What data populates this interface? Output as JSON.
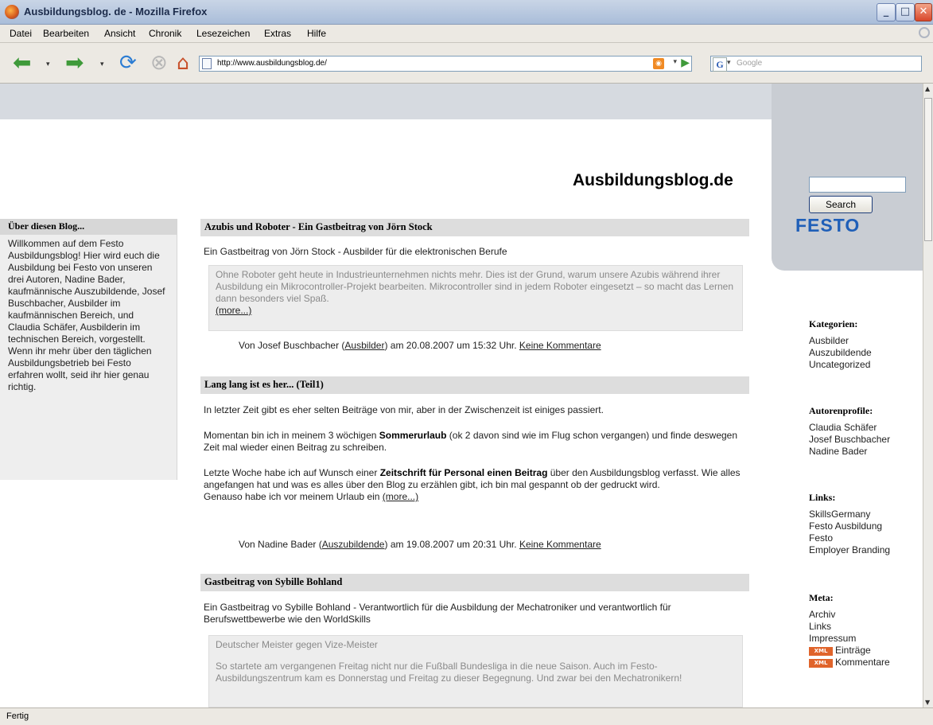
{
  "window": {
    "title": "Ausbildungsblog. de - Mozilla Firefox",
    "minimize": "_",
    "maximize": "□",
    "close": "✕"
  },
  "menu": [
    "Datei",
    "Bearbeiten",
    "Ansicht",
    "Chronik",
    "Lesezeichen",
    "Extras",
    "Hilfe"
  ],
  "nav": {
    "back_icon": "back-arrow-icon",
    "forward_icon": "forward-arrow-icon",
    "url": "http://www.ausbildungsblog.de/",
    "search_placeholder": "Google"
  },
  "page": {
    "blog_title": "Ausbildungsblog.de",
    "brand": "FESTO",
    "about": {
      "heading": "Über diesen Blog...",
      "text": "Willkommen auf dem Festo Ausbildungsblog! Hier wird euch die Ausbildung bei Festo von unseren drei Autoren, Nadine Bader, kaufmännische Auszubildende, Josef Buschbacher, Ausbilder im kaufmännischen Bereich, und Claudia Schäfer, Ausbilderin im technischen Bereich, vorgestellt. Wenn ihr mehr über den täglichen Ausbildungsbetrieb bei Festo erfahren wollt, seid ihr hier genau richtig."
    },
    "posts": [
      {
        "title": "Azubis und Roboter - Ein Gastbeitrag von Jörn Stock",
        "intro": "Ein Gastbeitrag von Jörn Stock - Ausbilder für die elektronischen Berufe",
        "quote": "Ohne Roboter geht heute in Industrieunternehmen nichts mehr. Dies ist der Grund, warum unsere Azubis während ihrer Ausbildung ein Mikrocontroller-Projekt bearbeiten. Mikrocontroller sind in jedem Roboter eingesetzt – so macht das Lernen dann besonders viel Spaß.",
        "more": "(more...)",
        "meta_prefix": "Von Josef Buschbacher (",
        "meta_cat": "Ausbilder",
        "meta_date": ") am 20.08.2007 um 15:32 Uhr.",
        "meta_comments": "Keine Kommentare"
      },
      {
        "title": "Lang lang ist es her... (Teil1)",
        "p1": "In letzter Zeit gibt es eher selten Beiträge von mir, aber in der Zwischenzeit ist einiges passiert.",
        "p2_a": "Momentan bin ich in meinem 3 wöchigen ",
        "p2_b": "Sommerurlaub",
        "p2_c": " (ok 2 davon sind wie im Flug schon vergangen) und finde deswegen Zeit mal wieder einen Beitrag zu schreiben.",
        "p3_a": "Letzte Woche habe ich auf Wunsch einer ",
        "p3_b": "Zeitschrift für Personal einen Beitrag",
        "p3_c": " über den Ausbildungsblog verfasst. Wie alles angefangen hat und was es alles über den Blog zu erzählen gibt, ich bin mal gespannt ob der gedruckt wird.",
        "p4": "Genauso habe ich vor meinem Urlaub ein ",
        "more": "(more...)",
        "meta_prefix": "Von Nadine Bader (",
        "meta_cat": "Auszubildende",
        "meta_date": ") am 19.08.2007 um 20:31 Uhr.",
        "meta_comments": "Keine Kommentare"
      },
      {
        "title": "Gastbeitrag von Sybille Bohland",
        "intro": "Ein Gastbeitrag vo Sybille Bohland - Verantwortlich für die Ausbildung der Mechatroniker und verantwortlich für Berufswettbewerbe wie den WorldSkills",
        "quote_title": "Deutscher Meister gegen Vize-Meister",
        "quote": "So startete am vergangenen Freitag nicht nur die Fußball Bundesliga in die neue Saison. Auch im Festo-Ausbildungszentrum kam es Donnerstag und Freitag zu dieser Begegnung. Und zwar bei den Mechatronikern!"
      }
    ],
    "sidebar": {
      "search_button": "Search",
      "kategorien": {
        "heading": "Kategorien:",
        "items": [
          "Ausbilder",
          "Auszubildende",
          "Uncategorized"
        ]
      },
      "autoren": {
        "heading": "Autorenprofile:",
        "items": [
          "Claudia Schäfer",
          "Josef Buschbacher",
          "Nadine Bader"
        ]
      },
      "links": {
        "heading": "Links:",
        "items": [
          "SkillsGermany",
          "Festo Ausbildung",
          "Festo",
          "Employer Branding"
        ]
      },
      "meta": {
        "heading": "Meta:",
        "items": [
          "Archiv",
          "Links",
          "Impressum"
        ],
        "xml_badge": "XML",
        "feeds": [
          "Einträge",
          "Kommentare"
        ]
      }
    }
  },
  "status": "Fertig"
}
